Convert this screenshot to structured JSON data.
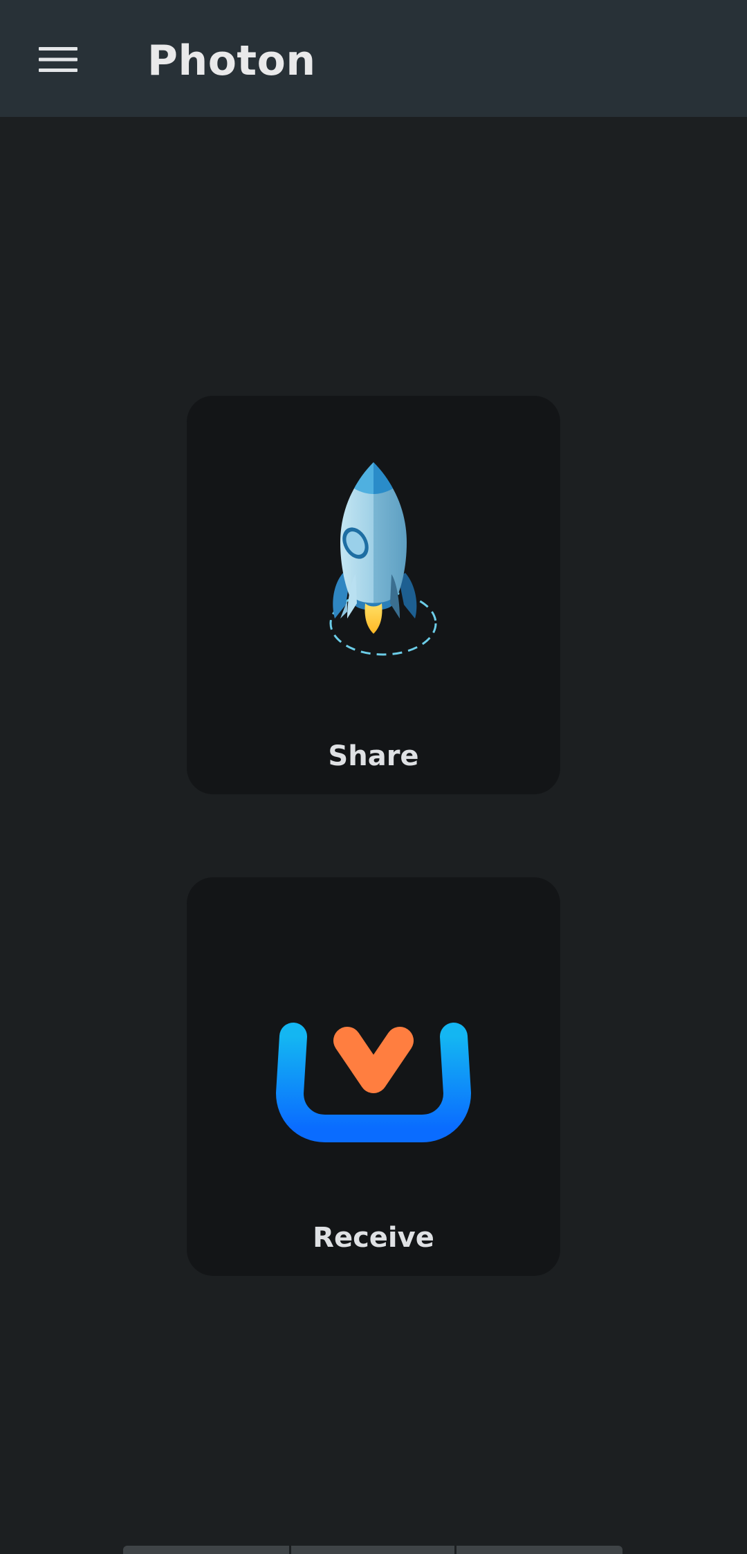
{
  "app": {
    "title": "Photon"
  },
  "colors": {
    "background": "#1c1f21",
    "appbar": "#283137",
    "card": "#131517",
    "text": "#dfe1e4"
  },
  "appbar": {
    "menu_icon": "hamburger-menu-icon"
  },
  "actions": [
    {
      "id": "share",
      "label": "Share",
      "icon": "rocket-icon"
    },
    {
      "id": "receive",
      "label": "Receive",
      "icon": "download-tray-icon"
    }
  ],
  "nav": {
    "handle_icon": "gesture-bar"
  }
}
